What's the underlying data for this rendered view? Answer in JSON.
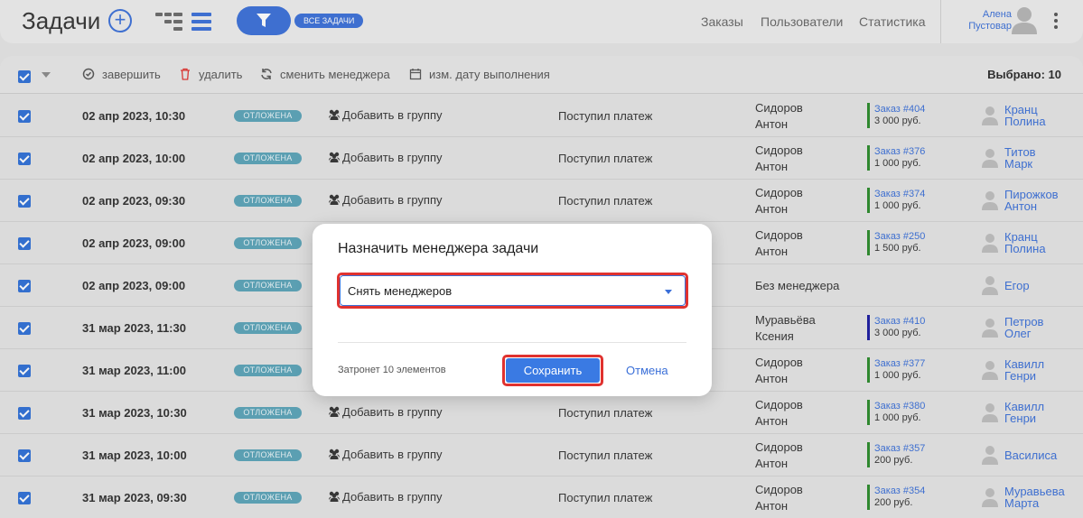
{
  "header": {
    "title": "Задачи",
    "filter_badge": "ВСЕ ЗАДАЧИ",
    "nav": [
      "Заказы",
      "Пользователи",
      "Статистика"
    ],
    "user_first": "Алена",
    "user_last": "Пустовар"
  },
  "toolbar": {
    "complete": "завершить",
    "delete": "удалить",
    "change_manager": "сменить менеджера",
    "change_date": "изм. дату выполнения",
    "selected": "Выбрано: 10"
  },
  "rows": [
    {
      "date": "02 апр 2023, 10:30",
      "status": "ОТЛОЖЕНА",
      "group": "Добавить в группу",
      "event": "Поступил платеж",
      "manager": [
        "Сидоров",
        "Антон"
      ],
      "order": "Заказ #404",
      "amount": "3 000 руб.",
      "order_color": "#2a8a2a",
      "person": [
        "Кранц",
        "Полина"
      ]
    },
    {
      "date": "02 апр 2023, 10:00",
      "status": "ОТЛОЖЕНА",
      "group": "Добавить в группу",
      "event": "Поступил платеж",
      "manager": [
        "Сидоров",
        "Антон"
      ],
      "order": "Заказ #376",
      "amount": "1 000 руб.",
      "order_color": "#2a8a2a",
      "person": [
        "Титов",
        "Марк"
      ]
    },
    {
      "date": "02 апр 2023, 09:30",
      "status": "ОТЛОЖЕНА",
      "group": "Добавить в группу",
      "event": "Поступил платеж",
      "manager": [
        "Сидоров",
        "Антон"
      ],
      "order": "Заказ #374",
      "amount": "1 000 руб.",
      "order_color": "#2a8a2a",
      "person": [
        "Пирожков",
        "Антон"
      ]
    },
    {
      "date": "02 апр 2023, 09:00",
      "status": "ОТЛОЖЕНА",
      "group": "",
      "event": "",
      "manager": [
        "Сидоров",
        "Антон"
      ],
      "order": "Заказ #250",
      "amount": "1 500 руб.",
      "order_color": "#2a8a2a",
      "person": [
        "Кранц",
        "Полина"
      ]
    },
    {
      "date": "02 апр 2023, 09:00",
      "status": "ОТЛОЖЕНА",
      "group": "",
      "event": "",
      "manager": [
        "Без менеджера"
      ],
      "order": "",
      "amount": "",
      "order_color": "",
      "person": [
        "Егор"
      ]
    },
    {
      "date": "31 мар 2023, 11:30",
      "status": "ОТЛОЖЕНА",
      "group": "",
      "event": "",
      "manager": [
        "Муравьёва",
        "Ксения"
      ],
      "order": "Заказ #410",
      "amount": "3 000 руб.",
      "order_color": "#1a1aa0",
      "person": [
        "Петров",
        "Олег"
      ]
    },
    {
      "date": "31 мар 2023, 11:00",
      "status": "ОТЛОЖЕНА",
      "group": "",
      "event": "",
      "manager": [
        "Сидоров",
        "Антон"
      ],
      "order": "Заказ #377",
      "amount": "1 000 руб.",
      "order_color": "#2a8a2a",
      "person": [
        "Кавилл",
        "Генри"
      ]
    },
    {
      "date": "31 мар 2023, 10:30",
      "status": "ОТЛОЖЕНА",
      "group": "Добавить в группу",
      "event": "Поступил платеж",
      "manager": [
        "Сидоров",
        "Антон"
      ],
      "order": "Заказ #380",
      "amount": "1 000 руб.",
      "order_color": "#2a8a2a",
      "person": [
        "Кавилл",
        "Генри"
      ]
    },
    {
      "date": "31 мар 2023, 10:00",
      "status": "ОТЛОЖЕНА",
      "group": "Добавить в группу",
      "event": "Поступил платеж",
      "manager": [
        "Сидоров",
        "Антон"
      ],
      "order": "Заказ #357",
      "amount": "200 руб.",
      "order_color": "#2a8a2a",
      "person": [
        "Василиса"
      ]
    },
    {
      "date": "31 мар 2023, 09:30",
      "status": "ОТЛОЖЕНА",
      "group": "Добавить в группу",
      "event": "Поступил платеж",
      "manager": [
        "Сидоров",
        "Антон"
      ],
      "order": "Заказ #354",
      "amount": "200 руб.",
      "order_color": "#2a8a2a",
      "person": [
        "Муравьева",
        "Марта"
      ]
    }
  ],
  "modal": {
    "title": "Назначить менеджера задачи",
    "select_value": "Снять менеджеров",
    "note": "Затронет 10 элементов",
    "save": "Сохранить",
    "cancel": "Отмена"
  }
}
